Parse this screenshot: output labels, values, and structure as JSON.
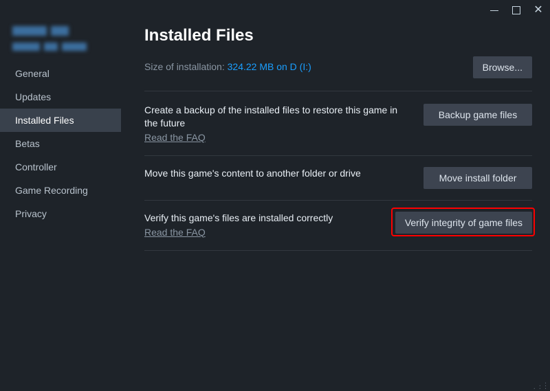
{
  "titlebar": {
    "close_glyph": "✕"
  },
  "sidebar": {
    "items": [
      {
        "label": "General"
      },
      {
        "label": "Updates"
      },
      {
        "label": "Installed Files"
      },
      {
        "label": "Betas"
      },
      {
        "label": "Controller"
      },
      {
        "label": "Game Recording"
      },
      {
        "label": "Privacy"
      }
    ]
  },
  "content": {
    "title": "Installed Files",
    "size_label": "Size of installation: ",
    "size_value": "324.22 MB on D (I:)",
    "browse_button": "Browse...",
    "backup": {
      "desc": "Create a backup of the installed files to restore this game in the future",
      "faq": "Read the FAQ",
      "button": "Backup game files"
    },
    "move": {
      "desc": "Move this game's content to another folder or drive",
      "button": "Move install folder"
    },
    "verify": {
      "desc": "Verify this game's files are installed correctly",
      "faq": "Read the FAQ",
      "button": "Verify integrity of game files"
    }
  }
}
